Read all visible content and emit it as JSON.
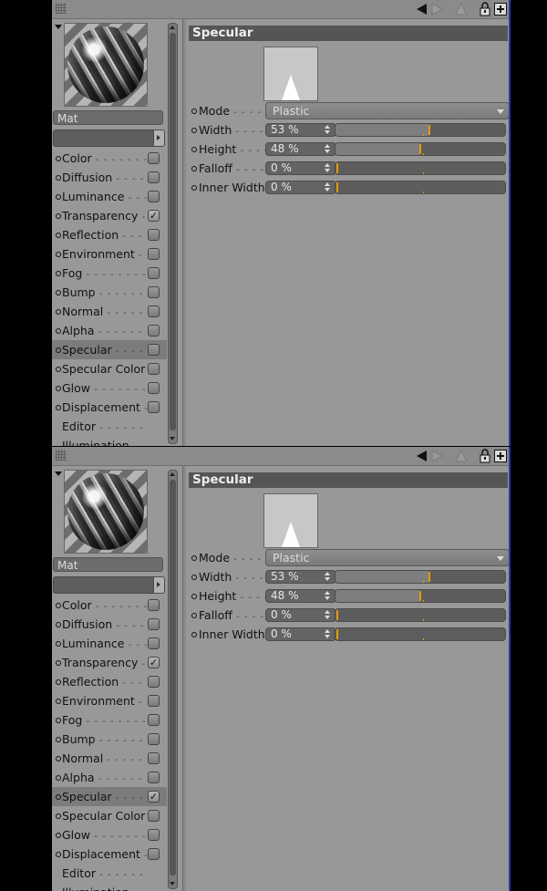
{
  "panels": [
    {
      "material_name": "Mat",
      "section_title": "Specular",
      "channels": [
        {
          "label": "Color",
          "checked": false,
          "show_check": true,
          "selected": false
        },
        {
          "label": "Diffusion",
          "checked": false,
          "show_check": true,
          "selected": false
        },
        {
          "label": "Luminance",
          "checked": false,
          "show_check": true,
          "selected": false
        },
        {
          "label": "Transparency",
          "checked": true,
          "show_check": true,
          "selected": false
        },
        {
          "label": "Reflection",
          "checked": false,
          "show_check": true,
          "selected": false
        },
        {
          "label": "Environment",
          "checked": false,
          "show_check": true,
          "selected": false
        },
        {
          "label": "Fog",
          "checked": false,
          "show_check": true,
          "selected": false
        },
        {
          "label": "Bump",
          "checked": false,
          "show_check": true,
          "selected": false
        },
        {
          "label": "Normal",
          "checked": false,
          "show_check": true,
          "selected": false
        },
        {
          "label": "Alpha",
          "checked": false,
          "show_check": true,
          "selected": false
        },
        {
          "label": "Specular",
          "checked": false,
          "show_check": true,
          "selected": true
        },
        {
          "label": "Specular Color",
          "checked": false,
          "show_check": true,
          "selected": false
        },
        {
          "label": "Glow",
          "checked": false,
          "show_check": true,
          "selected": false
        },
        {
          "label": "Displacement",
          "checked": false,
          "show_check": true,
          "selected": false
        },
        {
          "label": "Editor",
          "checked": false,
          "show_check": false,
          "selected": false
        },
        {
          "label": "Illumination",
          "checked": false,
          "show_check": false,
          "selected": false
        }
      ],
      "mode": {
        "label": "Mode",
        "value": "Plastic"
      },
      "params": [
        {
          "label": "Width",
          "value": "53 %",
          "fraction": 0.53
        },
        {
          "label": "Height",
          "value": "48 %",
          "fraction": 0.48
        },
        {
          "label": "Falloff",
          "value": "0 %",
          "fraction": 0.0
        },
        {
          "label": "Inner Width",
          "value": "0 %",
          "fraction": 0.0
        }
      ]
    },
    {
      "material_name": "Mat",
      "section_title": "Specular",
      "channels": [
        {
          "label": "Color",
          "checked": false,
          "show_check": true,
          "selected": false
        },
        {
          "label": "Diffusion",
          "checked": false,
          "show_check": true,
          "selected": false
        },
        {
          "label": "Luminance",
          "checked": false,
          "show_check": true,
          "selected": false
        },
        {
          "label": "Transparency",
          "checked": true,
          "show_check": true,
          "selected": false
        },
        {
          "label": "Reflection",
          "checked": false,
          "show_check": true,
          "selected": false
        },
        {
          "label": "Environment",
          "checked": false,
          "show_check": true,
          "selected": false
        },
        {
          "label": "Fog",
          "checked": false,
          "show_check": true,
          "selected": false
        },
        {
          "label": "Bump",
          "checked": false,
          "show_check": true,
          "selected": false
        },
        {
          "label": "Normal",
          "checked": false,
          "show_check": true,
          "selected": false
        },
        {
          "label": "Alpha",
          "checked": false,
          "show_check": true,
          "selected": false
        },
        {
          "label": "Specular",
          "checked": true,
          "show_check": true,
          "selected": true
        },
        {
          "label": "Specular Color",
          "checked": false,
          "show_check": true,
          "selected": false
        },
        {
          "label": "Glow",
          "checked": false,
          "show_check": true,
          "selected": false
        },
        {
          "label": "Displacement",
          "checked": false,
          "show_check": true,
          "selected": false
        },
        {
          "label": "Editor",
          "checked": false,
          "show_check": false,
          "selected": false
        },
        {
          "label": "Illumination",
          "checked": false,
          "show_check": false,
          "selected": false
        }
      ],
      "mode": {
        "label": "Mode",
        "value": "Plastic"
      },
      "params": [
        {
          "label": "Width",
          "value": "53 %",
          "fraction": 0.53
        },
        {
          "label": "Height",
          "value": "48 %",
          "fraction": 0.48
        },
        {
          "label": "Falloff",
          "value": "0 %",
          "fraction": 0.0
        },
        {
          "label": "Inner Width",
          "value": "0 %",
          "fraction": 0.0
        }
      ]
    }
  ],
  "icons": [
    "grip-icon",
    "back-arrow-icon",
    "forward-arrow-icon",
    "up-arrow-icon",
    "lock-icon",
    "new-panel-icon"
  ],
  "colors": {
    "accent_marker": "#e39a0b",
    "panel_bg": "#989898",
    "header_bg": "#555555",
    "window_border": "#2b3aa8"
  }
}
